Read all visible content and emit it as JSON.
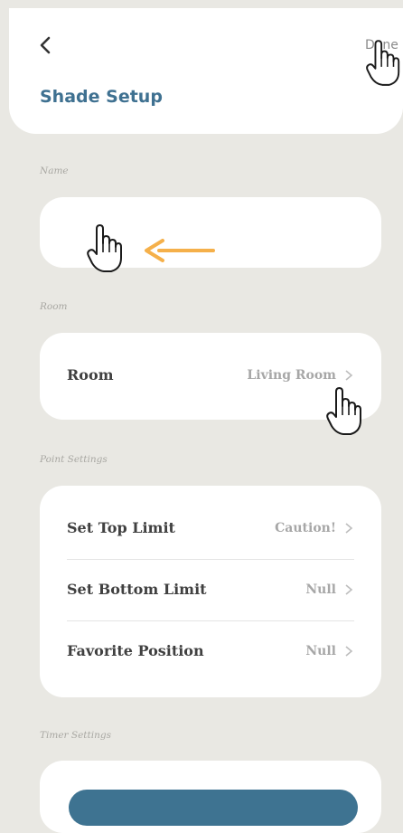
{
  "header": {
    "title": "Shade Setup",
    "done_label": "Done",
    "back_icon": "chevron-left-icon"
  },
  "sections": {
    "name_label": "Name",
    "room_label": "Room",
    "point_settings_label": "Point Settings",
    "timer_settings_label": "Timer Settings"
  },
  "name_field": {
    "value": "",
    "placeholder": ""
  },
  "room_row": {
    "label": "Room",
    "value": "Living Room"
  },
  "point_settings": [
    {
      "label": "Set Top Limit",
      "value": "Caution!"
    },
    {
      "label": "Set Bottom Limit",
      "value": "Null"
    },
    {
      "label": "Favorite Position",
      "value": "Null"
    }
  ],
  "colors": {
    "accent": "#3f7191",
    "background": "#e9e8e3",
    "arrow": "#f5b04a"
  },
  "annotations": {
    "pointer_icon": "hand-pointer-icon",
    "arrow_icon": "arrow-left-icon"
  }
}
